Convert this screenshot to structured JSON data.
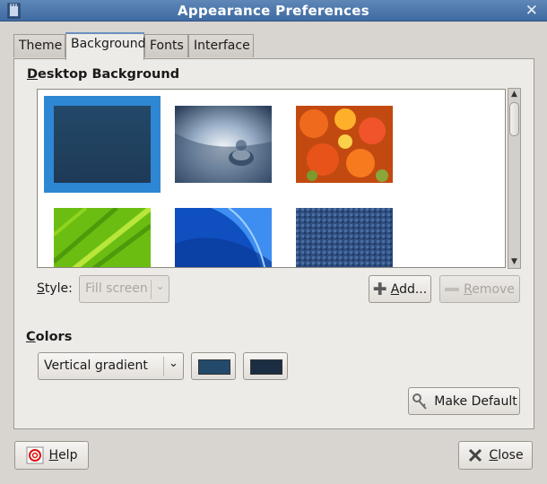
{
  "window": {
    "title": "Appearance Preferences"
  },
  "tabs": [
    {
      "label": "Theme"
    },
    {
      "label": "Background",
      "active": true
    },
    {
      "label": "Fonts"
    },
    {
      "label": "Interface"
    }
  ],
  "background": {
    "section_label": "Desktop Background",
    "section_mnemonic": "D",
    "section_rest": "esktop Background",
    "wallpapers": [
      {
        "id": "solid-blue",
        "selected": true
      },
      {
        "id": "water-drop"
      },
      {
        "id": "orange-flowers"
      },
      {
        "id": "green-leaf"
      },
      {
        "id": "blue-waves"
      },
      {
        "id": "blue-fabric"
      }
    ],
    "style_label_mnemonic": "S",
    "style_label_rest": "tyle:",
    "style_value": "Fill screen",
    "add_button_mnemonic": "A",
    "add_button_rest": "dd...",
    "remove_button_mnemonic": "R",
    "remove_button_rest": "emove"
  },
  "colors": {
    "section_mnemonic": "C",
    "section_rest": "olors",
    "mode_value": "Vertical gradient",
    "primary": "#234a6b",
    "secondary": "#1a2d42",
    "make_default_label": "Make Default"
  },
  "footer": {
    "help_mnemonic": "H",
    "help_rest": "elp",
    "close_mnemonic": "C",
    "close_rest": "lose"
  }
}
